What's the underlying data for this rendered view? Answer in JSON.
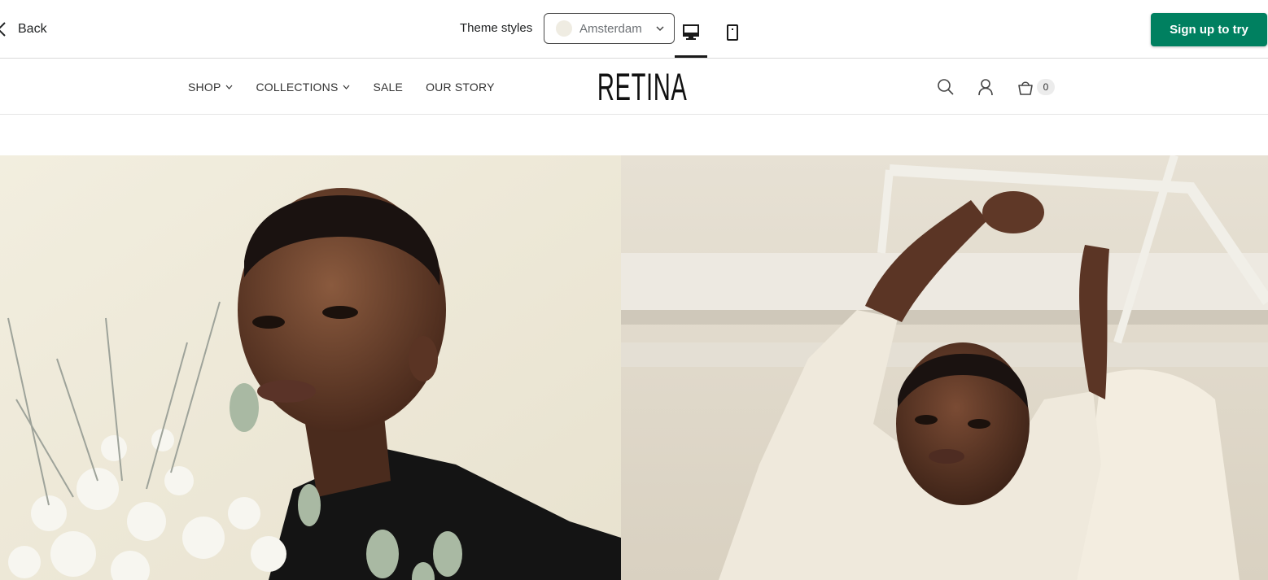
{
  "editor": {
    "back_label": "Back",
    "theme_styles_label": "Theme styles",
    "theme_selected": "Amsterdam",
    "signup_label": "Sign up to try",
    "active_device": "desktop"
  },
  "store": {
    "logo": "RETINA",
    "nav": [
      {
        "label": "SHOP",
        "has_dropdown": true
      },
      {
        "label": "COLLECTIONS",
        "has_dropdown": true
      },
      {
        "label": "SALE",
        "has_dropdown": false
      },
      {
        "label": "OUR STORY",
        "has_dropdown": false
      }
    ],
    "cart_count": "0",
    "icons": [
      "search-icon",
      "account-icon",
      "cart-icon"
    ]
  },
  "colors": {
    "signup_green": "#008060",
    "swatch": "#efece2"
  }
}
